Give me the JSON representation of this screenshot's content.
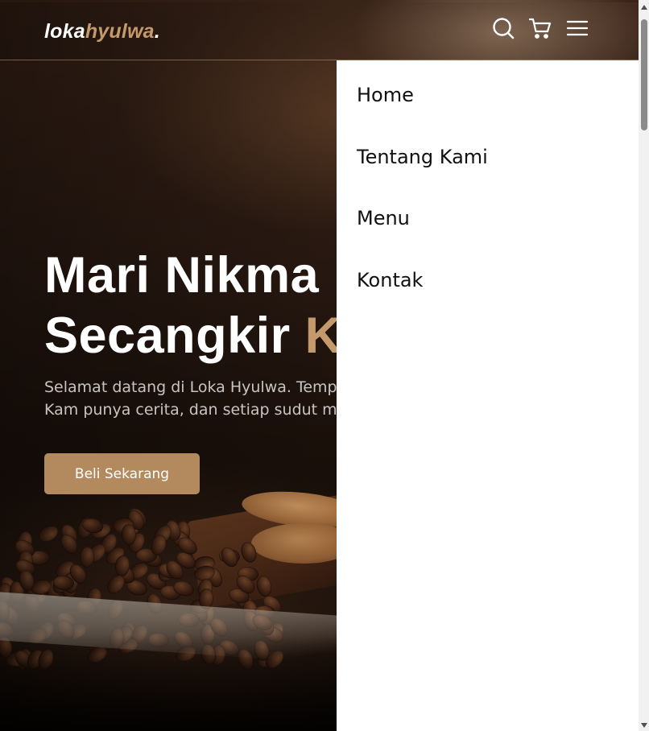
{
  "brand": {
    "part1": "loka",
    "part2": "hyulwa",
    "dot": "."
  },
  "nav_icons": [
    "search-icon",
    "cart-icon",
    "hamburger-menu-icon"
  ],
  "hero": {
    "title_line1": "Mari Nikma",
    "title_line2_prefix": "Secangkir ",
    "title_line2_accent": "K",
    "description": "Selamat datang di Loka Hyulwa. Temp bertemu hangatnya pertemuan. Kam punya cerita, dan setiap sudut memil",
    "cta_label": "Beli Sekarang"
  },
  "side_menu": {
    "items": [
      {
        "label": "Home"
      },
      {
        "label": "Tentang Kami"
      },
      {
        "label": "Menu"
      },
      {
        "label": "Kontak"
      }
    ]
  },
  "colors": {
    "accent": "#c49a6c",
    "button": "#b38a5e",
    "menu_background": "#ffffff"
  }
}
